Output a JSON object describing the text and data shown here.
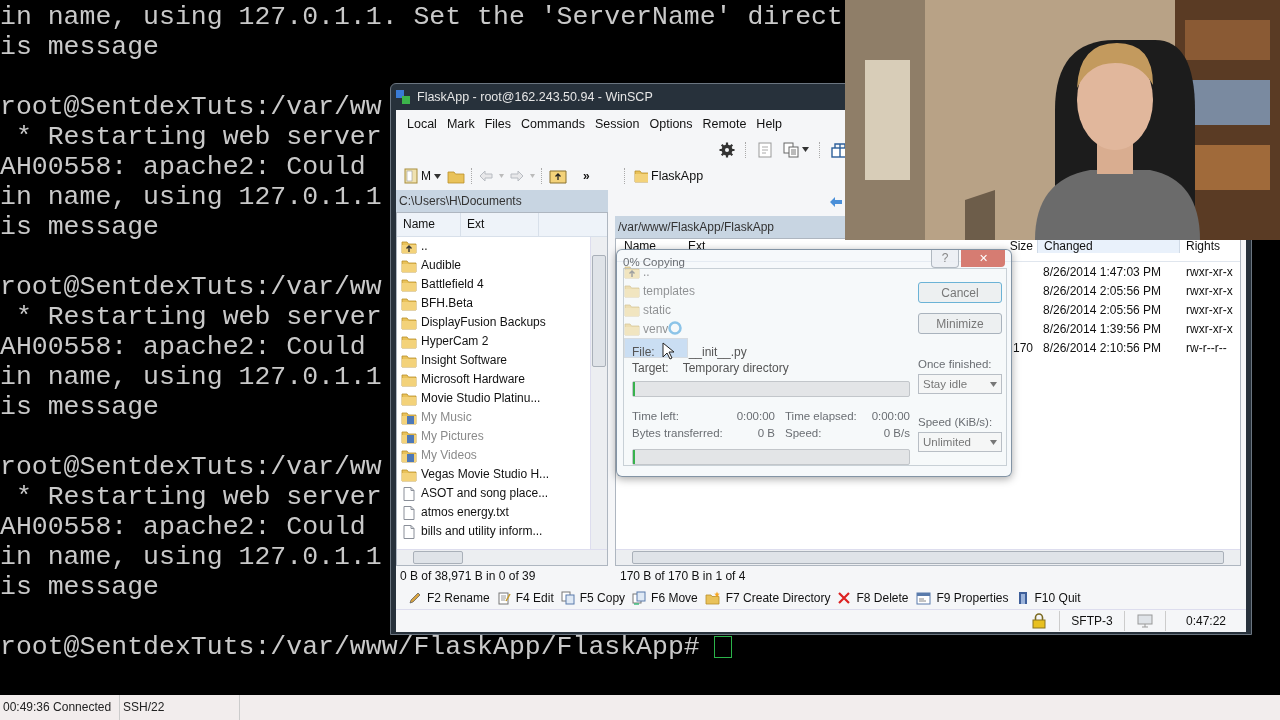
{
  "terminal": {
    "blocks": [
      [
        "in name, using 127.0.1.1. Set the 'ServerName' direct",
        "is message"
      ],
      [
        "root@SentdexTuts:/var/ww",
        " * Restarting web server",
        "AH00558: apache2: Could",
        "in name, using 127.0.1.1",
        "is message"
      ],
      [
        "root@SentdexTuts:/var/ww",
        " * Restarting web server",
        "AH00558: apache2: Could",
        "in name, using 127.0.1.1",
        "is message"
      ],
      [
        "root@SentdexTuts:/var/ww",
        " * Restarting web server",
        "AH00558: apache2: Could",
        "in name, using 127.0.1.1",
        "is message"
      ],
      [
        "root@SentdexTuts:/var/www/FlaskApp/FlaskApp#"
      ]
    ],
    "cursor_visible": true,
    "status": [
      "00:49:36 Connected",
      "SSH/22"
    ]
  },
  "window": {
    "title": "FlaskApp - root@162.243.50.94 - WinSCP",
    "menu": [
      "Local",
      "Mark",
      "Files",
      "Commands",
      "Session",
      "Options",
      "Remote",
      "Help"
    ],
    "local": {
      "drive": "M",
      "more": "»",
      "path": "C:\\Users\\H\\Documents",
      "columns": [
        "Name",
        "Ext"
      ],
      "rows": [
        {
          "name": "..",
          "kind": "up"
        },
        {
          "name": "Audible",
          "kind": "folder"
        },
        {
          "name": "Battlefield 4",
          "kind": "folder"
        },
        {
          "name": "BFH.Beta",
          "kind": "folder"
        },
        {
          "name": "DisplayFusion Backups",
          "kind": "folder"
        },
        {
          "name": "HyperCam 2",
          "kind": "folder"
        },
        {
          "name": "Insight Software",
          "kind": "folder"
        },
        {
          "name": "Microsoft Hardware",
          "kind": "folder"
        },
        {
          "name": "Movie Studio Platinu...",
          "kind": "folder"
        },
        {
          "name": "My Music",
          "kind": "special"
        },
        {
          "name": "My Pictures",
          "kind": "special"
        },
        {
          "name": "My Videos",
          "kind": "special"
        },
        {
          "name": "Vegas Movie Studio H...",
          "kind": "folder"
        },
        {
          "name": "ASOT and song place...",
          "kind": "file"
        },
        {
          "name": "atmos energy.txt",
          "kind": "file"
        },
        {
          "name": "bills and utility inform...",
          "kind": "file"
        }
      ],
      "summary": "0 B of 38,971 B in 0 of 39"
    },
    "remote": {
      "folder": "FlaskApp",
      "path": "/var/www/FlaskApp/FlaskApp",
      "columns": [
        "Name",
        "Ext",
        "Size",
        "Changed",
        "Rights"
      ],
      "rows": [
        {
          "name": "..",
          "kind": "up",
          "changed": "8/26/2014 1:47:03 PM",
          "rights": "rwxr-xr-x",
          "selected": false
        },
        {
          "name": "templates",
          "kind": "folder",
          "changed": "8/26/2014 2:05:56 PM",
          "rights": "rwxr-xr-x",
          "selected": false
        },
        {
          "name": "static",
          "kind": "folder",
          "changed": "8/26/2014 2:05:56 PM",
          "rights": "rwxr-xr-x",
          "selected": false
        },
        {
          "name": "venv",
          "kind": "folder",
          "changed": "8/26/2014 1:39:56 PM",
          "rights": "rwxr-xr-x",
          "selected": false
        },
        {
          "kind": "file",
          "size": "170",
          "changed": "8/26/2014 2:10:56 PM",
          "rights": "rw-r--r--",
          "selected": true
        }
      ],
      "summary": "170 B of 170 B in 1 of 4"
    },
    "commands": [
      {
        "label": "F2 Rename",
        "kind": "rename"
      },
      {
        "label": "F4 Edit",
        "kind": "edit"
      },
      {
        "label": "F5 Copy",
        "kind": "copy"
      },
      {
        "label": "F6 Move",
        "kind": "move"
      },
      {
        "label": "F7 Create Directory",
        "kind": "mkdir"
      },
      {
        "label": "F8 Delete",
        "kind": "delete"
      },
      {
        "label": "F9 Properties",
        "kind": "properties"
      },
      {
        "label": "F10 Quit",
        "kind": "quit"
      }
    ],
    "status": {
      "protocol": "SFTP-3",
      "time": "0:47:22"
    }
  },
  "copy_dialog": {
    "title": "0% Copying",
    "help": "?",
    "close": "✕",
    "file_label": "File:",
    "file": "__init__.py",
    "target_label": "Target:",
    "target": "Temporary directory",
    "file_progress": {
      "level": 0
    },
    "time_left_label": "Time left:",
    "time_left": "0:00:00",
    "time_elapsed_label": "Time elapsed:",
    "time_elapsed": "0:00:00",
    "bytes_label": "Bytes transferred:",
    "bytes": "0 B",
    "speed_label": "Speed:",
    "speed": "0 B/s",
    "total_progress": {
      "level": 0
    },
    "buttons": [
      "Cancel",
      "Minimize"
    ],
    "once_finished_label": "Once finished:",
    "once_finished": "Stay idle",
    "speed_limit_label": "Speed (KiB/s):",
    "speed_limit": "Unlimited"
  }
}
